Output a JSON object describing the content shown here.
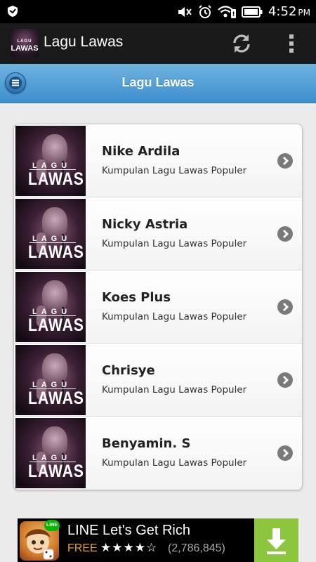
{
  "status_bar": {
    "time": "4:52",
    "ampm": "PM",
    "icons": [
      "shield-icon",
      "mute-icon",
      "alarm-icon",
      "wifi-icon",
      "battery-icon"
    ]
  },
  "action_bar": {
    "app_title": "Lagu Lawas",
    "logo": {
      "small": "LAGU",
      "big": "LAWAS"
    },
    "actions": [
      "refresh-icon",
      "overflow-menu-icon"
    ]
  },
  "page_header": {
    "title": "Lagu Lawas",
    "menu_icon": "menu-icon"
  },
  "list": {
    "items": [
      {
        "title": "Nike Ardila",
        "subtitle": "Kumpulan Lagu Lawas Populer",
        "thumb_small": "LAGU",
        "thumb_big": "LAWAS"
      },
      {
        "title": "Nicky Astria",
        "subtitle": "Kumpulan Lagu Lawas Populer",
        "thumb_small": "LAGU",
        "thumb_big": "LAWAS"
      },
      {
        "title": "Koes Plus",
        "subtitle": "Kumpulan Lagu Lawas Populer",
        "thumb_small": "LAGU",
        "thumb_big": "LAWAS"
      },
      {
        "title": "Chrisye",
        "subtitle": "Kumpulan Lagu Lawas Populer",
        "thumb_small": "LAGU",
        "thumb_big": "LAWAS"
      },
      {
        "title": "Benyamin. S",
        "subtitle": "Kumpulan Lagu Lawas Populer",
        "thumb_small": "LAGU",
        "thumb_big": "LAWAS"
      }
    ]
  },
  "ad": {
    "title": "LINE Let's Get Rich",
    "price": "FREE",
    "rating_stars": "★★★★☆",
    "rating_value": 4.5,
    "review_count": "(2,786,845)",
    "badge": "LINE",
    "accent": "#8cc63f",
    "price_color": "#e8a21d"
  }
}
